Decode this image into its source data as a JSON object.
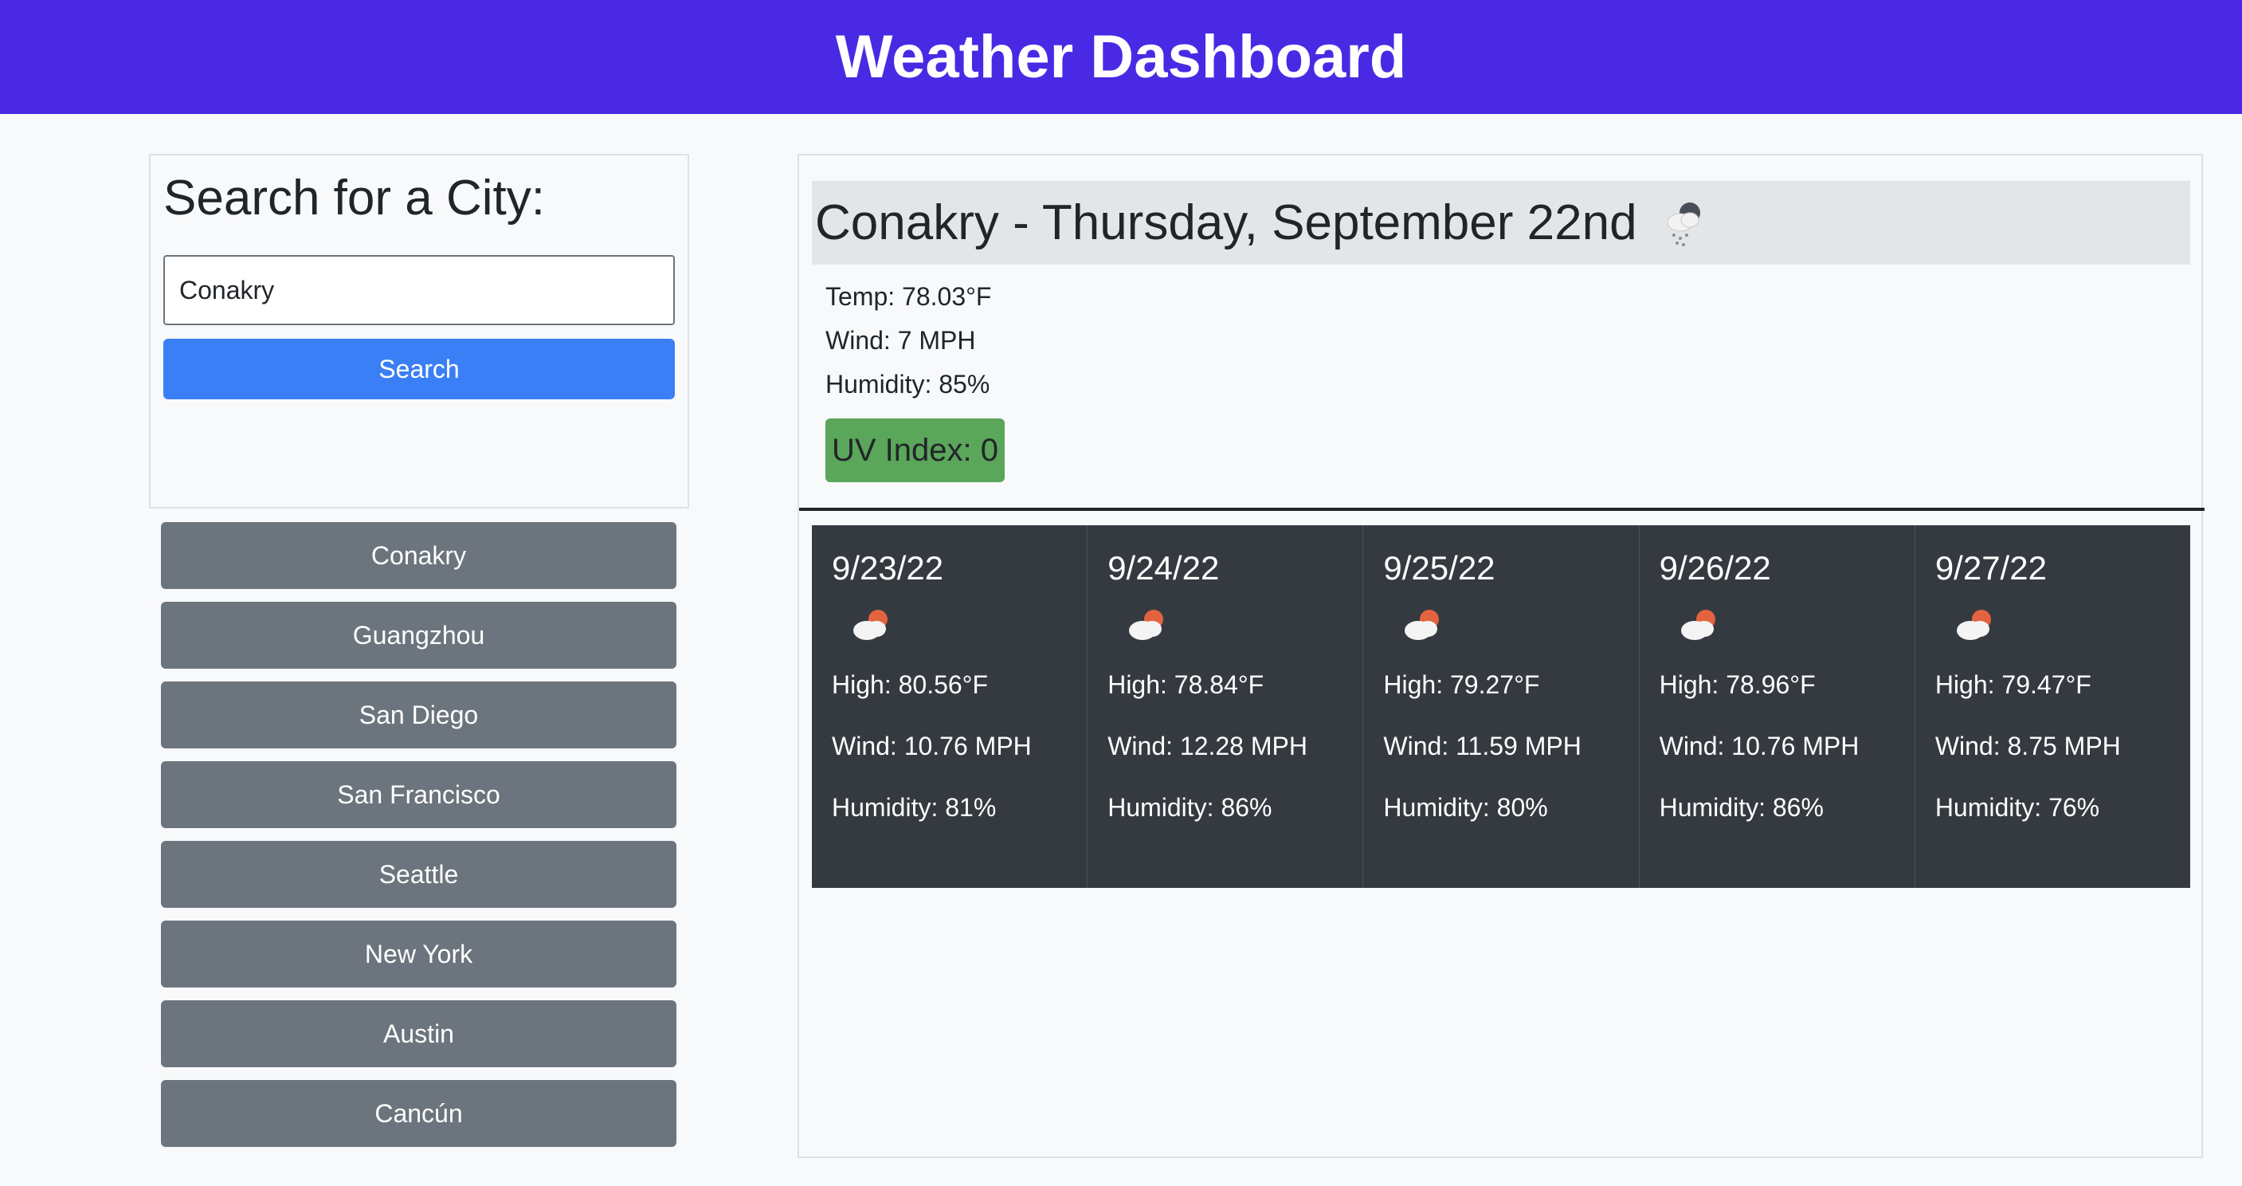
{
  "header": {
    "title": "Weather Dashboard"
  },
  "search": {
    "title": "Search for a City:",
    "value": "Conakry",
    "button_label": "Search"
  },
  "history": [
    "Conakry",
    "Guangzhou",
    "San Diego",
    "San Francisco",
    "Seattle",
    "New York",
    "Austin",
    "Cancún"
  ],
  "current": {
    "title": "Conakry - Thursday, September 22nd",
    "icon": "snow-cloud-icon",
    "temp": "Temp: 78.03°F",
    "wind": "Wind: 7 MPH",
    "humidity": "Humidity: 85%",
    "uv": "UV Index: 0",
    "uv_color": "#5aa65a"
  },
  "forecast": [
    {
      "date": "9/23/22",
      "icon": "partly-cloudy-icon",
      "high": "High: 80.56°F",
      "wind": "Wind: 10.76 MPH",
      "humidity": "Humidity: 81%"
    },
    {
      "date": "9/24/22",
      "icon": "partly-cloudy-icon",
      "high": "High: 78.84°F",
      "wind": "Wind: 12.28 MPH",
      "humidity": "Humidity: 86%"
    },
    {
      "date": "9/25/22",
      "icon": "partly-cloudy-icon",
      "high": "High: 79.27°F",
      "wind": "Wind: 11.59 MPH",
      "humidity": "Humidity: 80%"
    },
    {
      "date": "9/26/22",
      "icon": "partly-cloudy-icon",
      "high": "High: 78.96°F",
      "wind": "Wind: 10.76 MPH",
      "humidity": "Humidity: 86%"
    },
    {
      "date": "9/27/22",
      "icon": "partly-cloudy-icon",
      "high": "High: 79.47°F",
      "wind": "Wind: 8.75 MPH",
      "humidity": "Humidity: 76%"
    }
  ],
  "colors": {
    "header": "#4a29e4",
    "primary_button": "#3b7ff6",
    "secondary_button": "#6c757d",
    "forecast_bg": "#343a40"
  }
}
